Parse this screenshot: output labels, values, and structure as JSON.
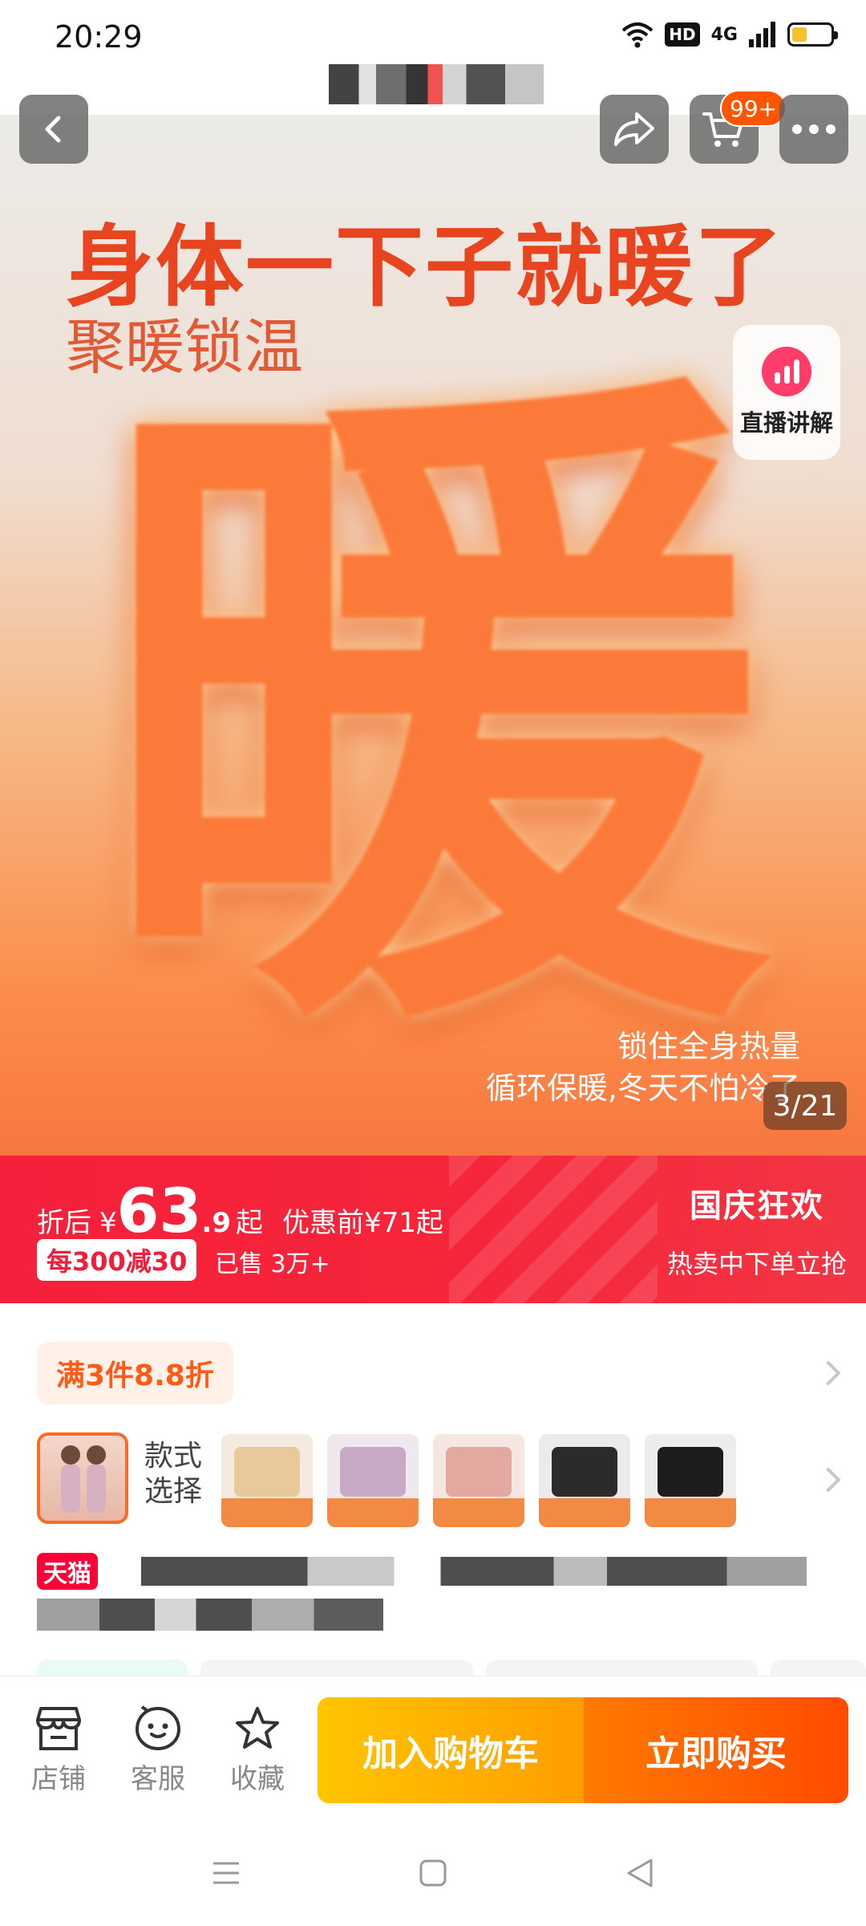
{
  "status_bar": {
    "time": "20:29",
    "hd_label": "HD",
    "network_label": "4G",
    "battery_level": 0.4
  },
  "top_bar": {
    "cart_badge": "99+"
  },
  "hero": {
    "line1": "身体一下子就暖了",
    "line2": "聚暖锁温",
    "big_char": "暖",
    "sub1": "锁住全身热量",
    "sub2": "循环保暖,冬天不怕冷了",
    "counter": "3/21",
    "live_label": "直播讲解"
  },
  "price": {
    "label": "折后",
    "currency": "¥",
    "integer": "63",
    "decimal": ".9",
    "suffix": "起",
    "original": "优惠前¥71起",
    "coupon": "每300减30",
    "sold": "已售 3万+",
    "promo_title": "国庆狂欢",
    "promo_sub": "热卖中下单立抢"
  },
  "discount": {
    "label": "满3件8.8折"
  },
  "variants": {
    "label": "款式选择"
  },
  "title": {
    "store_badge": "天猫"
  },
  "bottom_bar": {
    "store": "店铺",
    "service": "客服",
    "favorite": "收藏",
    "add_to_cart": "加入购物车",
    "buy_now": "立即购买"
  },
  "colors": {
    "accent": "#ff5500",
    "price_band": "#f5203b",
    "tmall": "#ff0036",
    "cart_button": "#ffb000",
    "buy_button": "#ff5a00"
  }
}
